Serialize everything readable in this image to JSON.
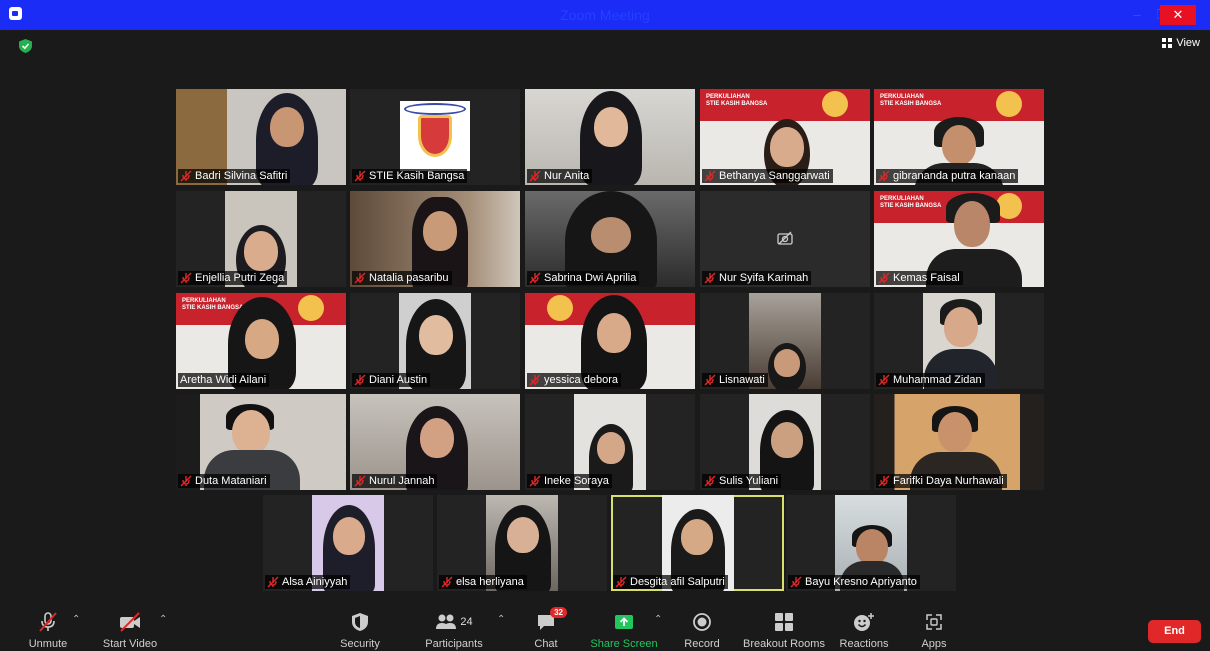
{
  "window": {
    "title": "Zoom Meeting",
    "controls": {
      "minimize": "–",
      "maximize": "❐",
      "close": "✕"
    }
  },
  "header": {
    "view_label": "View"
  },
  "participants": [
    {
      "name": "Badri Silvina Safitri"
    },
    {
      "name": "STIE Kasih Bangsa"
    },
    {
      "name": "Nur Anita"
    },
    {
      "name": "Bethanya Sanggarwati"
    },
    {
      "name": "gibrananda putra kanaan"
    },
    {
      "name": "Enjellia Putri Zega"
    },
    {
      "name": "Natalia pasaribu"
    },
    {
      "name": "Sabrina Dwi Aprilia"
    },
    {
      "name": "Nur Syifa Karimah"
    },
    {
      "name": "Kemas Faisal"
    },
    {
      "name": "Aretha Widi Ailani"
    },
    {
      "name": "Diani Austin"
    },
    {
      "name": "yessica debora"
    },
    {
      "name": "Lisnawati"
    },
    {
      "name": "Muhammad Zidan"
    },
    {
      "name": "Duta Mataniari"
    },
    {
      "name": "Nurul Jannah"
    },
    {
      "name": "Ineke Soraya"
    },
    {
      "name": "Sulis Yuliani"
    },
    {
      "name": "Farifki Daya Nurhawali"
    },
    {
      "name": "Alsa Ainiyyah"
    },
    {
      "name": "elsa herliyana"
    },
    {
      "name": "Desgita afil Salputri"
    },
    {
      "name": "Bayu Kresno Apriyanto"
    }
  ],
  "banner_text": "PERKULIAHAN\nSTIE KASIH BANGSA",
  "toolbar": {
    "unmute": "Unmute",
    "start_video": "Start Video",
    "security": "Security",
    "participants": "Participants",
    "participant_count": "24",
    "chat": "Chat",
    "chat_badge": "32",
    "share_screen": "Share Screen",
    "record": "Record",
    "breakout_rooms": "Breakout Rooms",
    "reactions": "Reactions",
    "apps": "Apps",
    "end": "End"
  },
  "colors": {
    "titlebar": "#1a2cf5",
    "share_screen": "#22c55e",
    "end_button": "#e02828",
    "active_speaker_border": "#d6e06b",
    "muted_icon": "#e02828"
  }
}
